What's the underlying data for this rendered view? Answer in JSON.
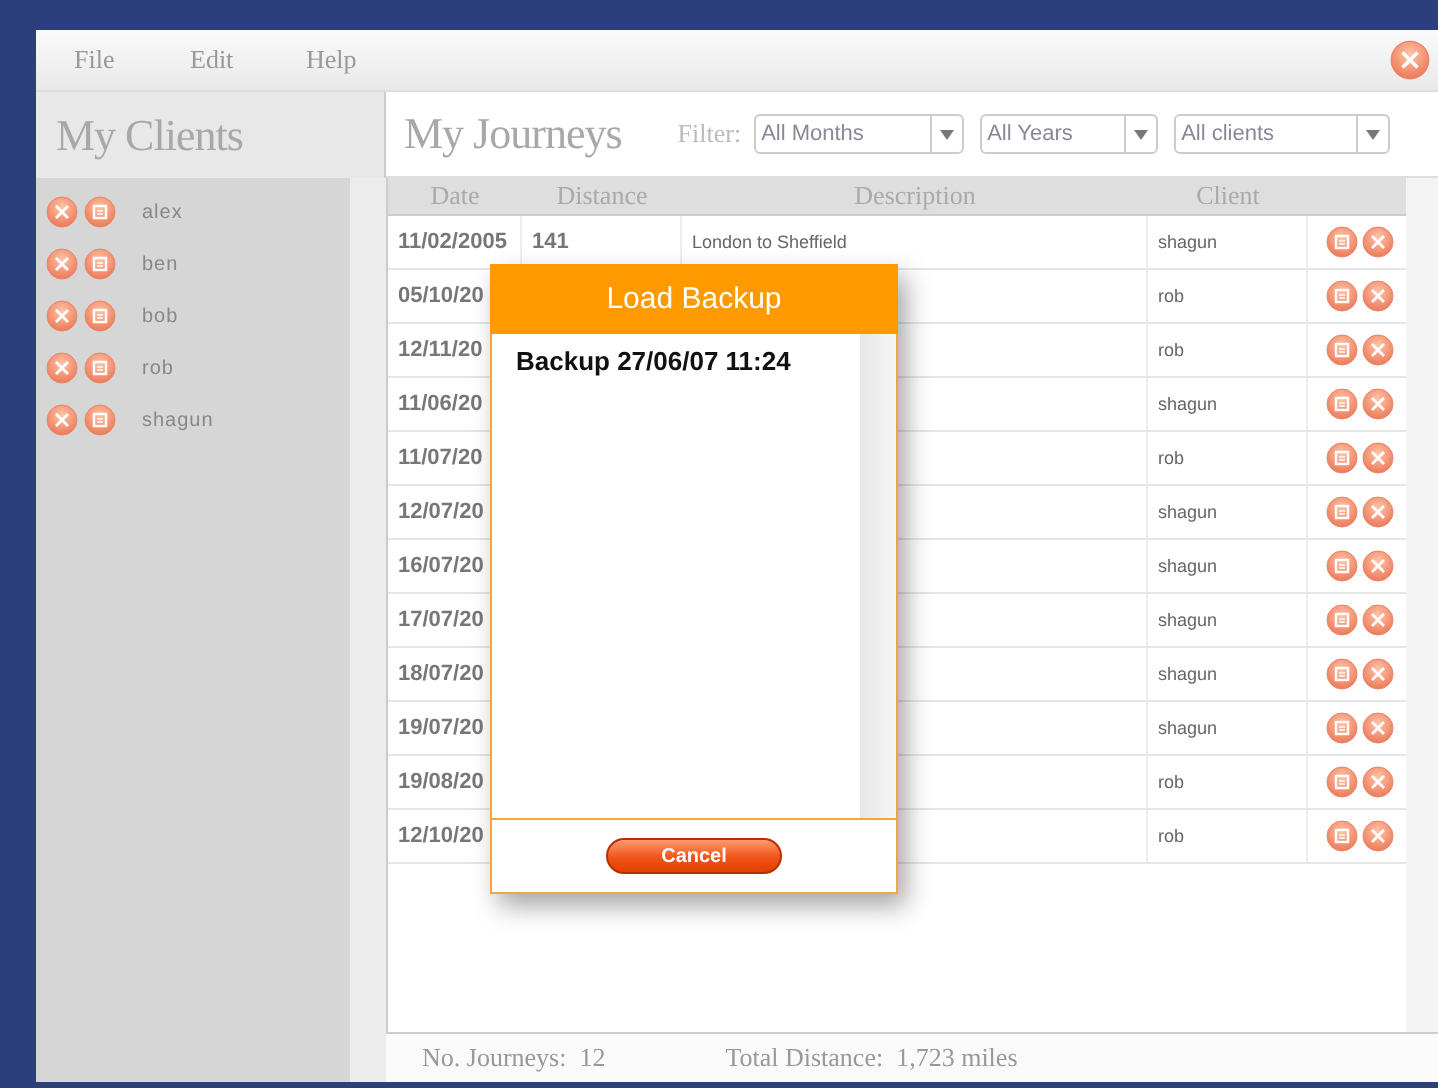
{
  "menu": [
    "File",
    "Edit",
    "Help"
  ],
  "clients": {
    "title": "My Clients",
    "items": [
      "alex",
      "ben",
      "bob",
      "rob",
      "shagun"
    ]
  },
  "journeys": {
    "title": "My Journeys",
    "filter_label": "Filter:",
    "filters": [
      "All Months",
      "All Years",
      "All clients"
    ],
    "columns": [
      "Date",
      "Distance",
      "Description",
      "Client"
    ],
    "rows": [
      {
        "date": "11/02/2005",
        "distance": "141",
        "description": "London to Sheffield",
        "client": "shagun"
      },
      {
        "date": "05/10/20",
        "client": "rob"
      },
      {
        "date": "12/11/20",
        "client": "rob"
      },
      {
        "date": "11/06/20",
        "client": "shagun"
      },
      {
        "date": "11/07/20",
        "client": "rob"
      },
      {
        "date": "12/07/20",
        "client": "shagun"
      },
      {
        "date": "16/07/20",
        "client": "shagun"
      },
      {
        "date": "17/07/20",
        "client": "shagun"
      },
      {
        "date": "18/07/20",
        "client": "shagun"
      },
      {
        "date": "19/07/20",
        "client": "shagun"
      },
      {
        "date": "19/08/20",
        "client": "rob"
      },
      {
        "date": "12/10/20",
        "client": "rob"
      }
    ],
    "footer": [
      "No. Journeys:  12",
      "Total Distance:  1,723 miles"
    ]
  },
  "dialog": {
    "title": "Load Backup",
    "items": [
      "Backup 27/06/07 11:24"
    ],
    "button": "Cancel"
  }
}
